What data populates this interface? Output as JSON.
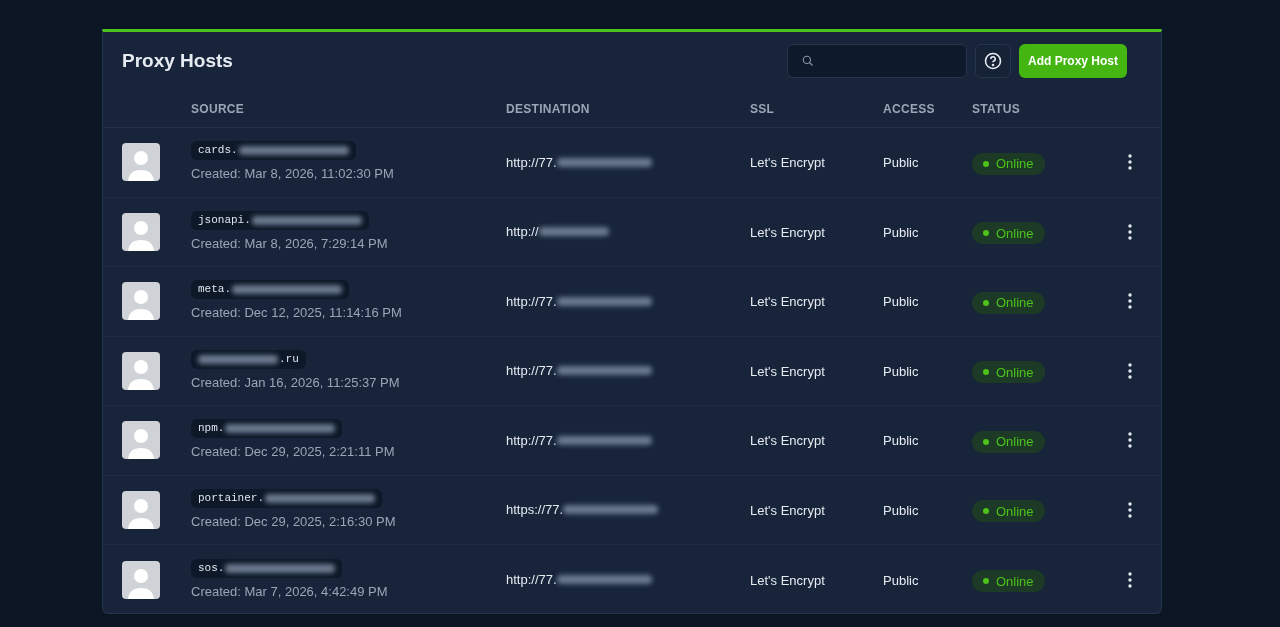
{
  "title": "Proxy Hosts",
  "add_button": "Add Proxy Host",
  "columns": [
    "SOURCE",
    "DESTINATION",
    "SSL",
    "ACCESS",
    "STATUS"
  ],
  "rows": [
    {
      "source_start": "cards.",
      "source_end": "",
      "created": "Created: Mar 8, 2026, 11:02:30 PM",
      "destination": "http://77.",
      "ssl": "Let's Encrypt",
      "access": "Public",
      "status": "Online",
      "color": "#4cc21a"
    },
    {
      "source_start": "jsonapi.",
      "source_end": "",
      "created": "Created: Mar 8, 2026, 7:29:14 PM",
      "destination": "http://",
      "ssl": "Let's Encrypt",
      "access": "Public",
      "status": "Online",
      "color": "#4cc21a"
    },
    {
      "source_start": "meta.",
      "source_end": "",
      "created": "Created: Dec 12, 2025, 11:14:16 PM",
      "destination": "http://77.",
      "ssl": "Let's Encrypt",
      "access": "Public",
      "status": "Online",
      "color": "#4cc21a"
    },
    {
      "source_start": "",
      "source_end": ".ru",
      "created": "Created: Jan 16, 2026, 11:25:37 PM",
      "destination": "http://77.",
      "ssl": "Let's Encrypt",
      "access": "Public",
      "status": "Online",
      "color": "#4cc21a"
    },
    {
      "source_start": "npm.",
      "source_end": "",
      "created": "Created: Dec 29, 2025, 2:21:11 PM",
      "destination": "http://77.",
      "ssl": "Let's Encrypt",
      "access": "Public",
      "status": "Online",
      "color": "#4cc21a"
    },
    {
      "source_start": "portainer.",
      "source_end": "",
      "created": "Created: Dec 29, 2025, 2:16:30 PM",
      "destination": "https://77.",
      "ssl": "Let's Encrypt",
      "access": "Public",
      "status": "Online",
      "color": "#4cc21a"
    },
    {
      "source_start": "sos.",
      "source_end": "",
      "created": "Created: Mar 7, 2026, 4:42:49 PM",
      "destination": "http://77.",
      "ssl": "Let's Encrypt",
      "access": "Public",
      "status": "Online",
      "color": "#4cc21a"
    }
  ]
}
